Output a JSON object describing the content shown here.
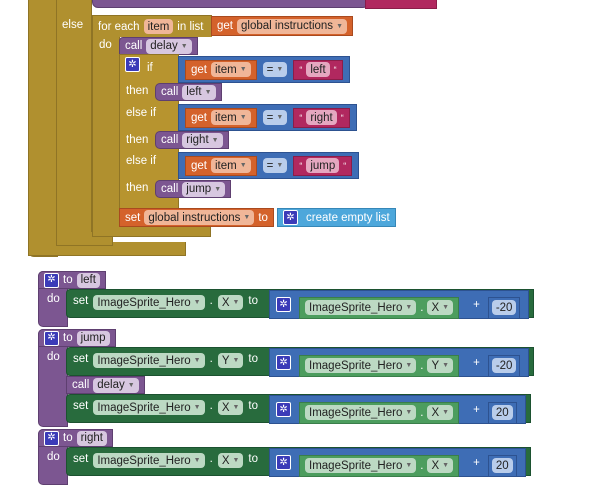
{
  "colors": {
    "control": "#B0902F",
    "procedure": "#7C5691",
    "variable": "#D4622B",
    "logic_math": "#3E6DB5",
    "text": "#B1285F",
    "component_setter": "#286B3D",
    "component_getter": "#4C9D5E",
    "list": "#4DA7DB"
  },
  "control": {
    "else_label": "else",
    "foreach": {
      "for_each": "for each",
      "var": "item",
      "in_list": "in list",
      "get": "get",
      "list": "global instructions",
      "do": "do"
    },
    "call_delay": {
      "call": "call",
      "proc": "delay"
    },
    "if_block": {
      "if": "if",
      "then": "then",
      "else_if": "else if",
      "branches": [
        {
          "get": "get",
          "var": "item",
          "op": "=",
          "text": "left",
          "call": "call",
          "proc": "left"
        },
        {
          "get": "get",
          "var": "item",
          "op": "=",
          "text": "right",
          "call": "call",
          "proc": "right"
        },
        {
          "get": "get",
          "var": "item",
          "op": "=",
          "text": "jump",
          "call": "call",
          "proc": "jump"
        }
      ]
    },
    "set_global": {
      "set": "set",
      "var": "global instructions",
      "to": "to",
      "value": "create empty list"
    }
  },
  "procedures": [
    {
      "to": "to",
      "name": "left",
      "do": "do",
      "statements": [
        {
          "type": "set",
          "set": "set",
          "component": "ImageSprite_Hero",
          "prop": "X",
          "to": "to",
          "get_component": "ImageSprite_Hero",
          "get_prop": "X",
          "op": "+",
          "number": "-20"
        }
      ]
    },
    {
      "to": "to",
      "name": "jump",
      "do": "do",
      "statements": [
        {
          "type": "set",
          "set": "set",
          "component": "ImageSprite_Hero",
          "prop": "Y",
          "to": "to",
          "get_component": "ImageSprite_Hero",
          "get_prop": "Y",
          "op": "+",
          "number": "-20"
        },
        {
          "type": "call",
          "call": "call",
          "proc": "delay"
        },
        {
          "type": "set",
          "set": "set",
          "component": "ImageSprite_Hero",
          "prop": "X",
          "to": "to",
          "get_component": "ImageSprite_Hero",
          "get_prop": "X",
          "op": "+",
          "number": "20"
        }
      ]
    },
    {
      "to": "to",
      "name": "right",
      "do": "do",
      "statements": [
        {
          "type": "set",
          "set": "set",
          "component": "ImageSprite_Hero",
          "prop": "X",
          "to": "to",
          "get_component": "ImageSprite_Hero",
          "get_prop": "X",
          "op": "+",
          "number": "20"
        }
      ]
    }
  ]
}
